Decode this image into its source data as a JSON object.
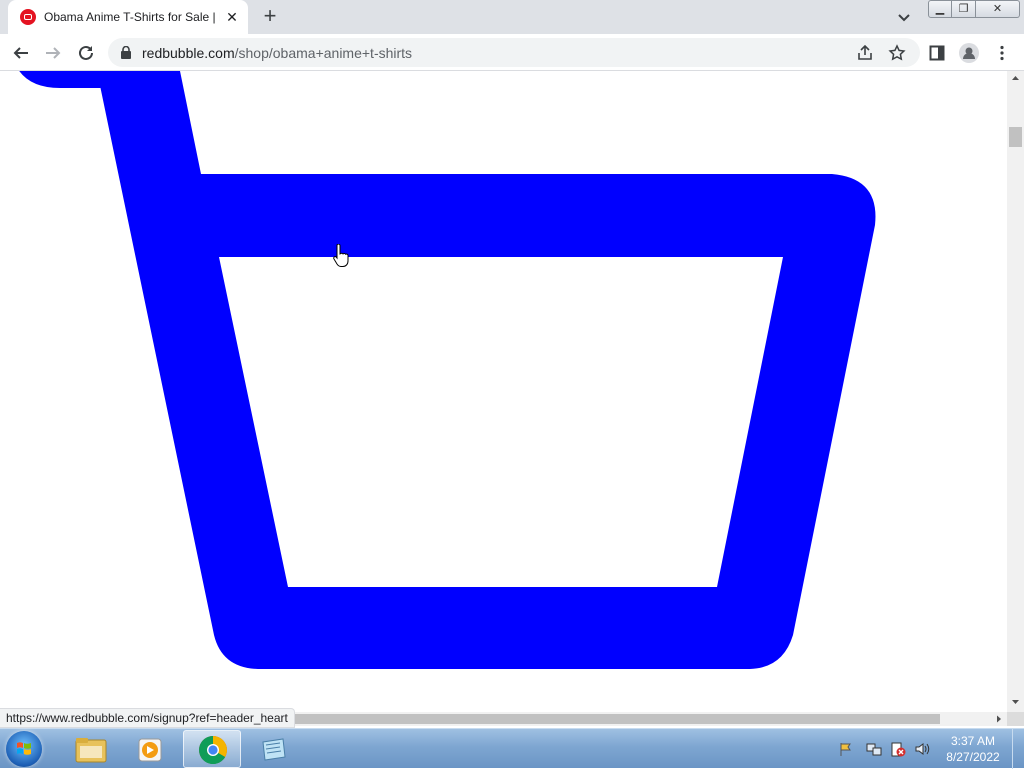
{
  "browser": {
    "tab": {
      "title": "Obama Anime T-Shirts for Sale | Redbubble",
      "favicon": "redbubble-favicon"
    },
    "new_tab_icon": "plus-icon",
    "window_controls": [
      "minimize",
      "restore",
      "close"
    ],
    "address": {
      "host": "redbubble.com",
      "path": "/shop/obama+anime+t-shirts"
    },
    "toolbar_icons": [
      "back-icon",
      "forward-icon",
      "reload-icon",
      "share-icon",
      "star-icon",
      "side-panel-icon",
      "profile-icon",
      "menu-icon"
    ]
  },
  "page": {
    "content": "cart-icon",
    "cart_color": "#0000ff"
  },
  "status_url": "https://www.redbubble.com/signup?ref=header_heart",
  "taskbar": {
    "apps": [
      "windows-explorer",
      "media-player",
      "chrome",
      "notepad"
    ],
    "clock": {
      "time": "3:37 AM",
      "date": "8/27/2022"
    }
  }
}
